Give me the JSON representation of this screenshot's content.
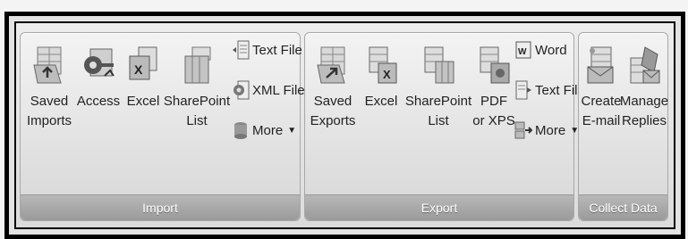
{
  "groups": {
    "import": {
      "title": "Import",
      "buttons": {
        "saved_imports": "Saved\nImports",
        "access": "Access",
        "excel": "Excel",
        "sharepoint_list": "SharePoint\nList"
      },
      "small": {
        "text_file": "Text File",
        "xml_file": "XML File",
        "more": "More"
      }
    },
    "export": {
      "title": "Export",
      "buttons": {
        "saved_exports": "Saved\nExports",
        "excel": "Excel",
        "sharepoint_list": "SharePoint\nList",
        "pdf_xps": "PDF\nor XPS"
      },
      "small": {
        "word": "Word",
        "text_file": "Text File",
        "more": "More"
      }
    },
    "collect": {
      "title": "Collect Data",
      "buttons": {
        "create_email": "Create\nE-mail",
        "manage_replies": "Manage\nReplies"
      }
    }
  },
  "colors": {
    "group_label_bg": "#a6a6a6",
    "frame_border": "#000000"
  }
}
